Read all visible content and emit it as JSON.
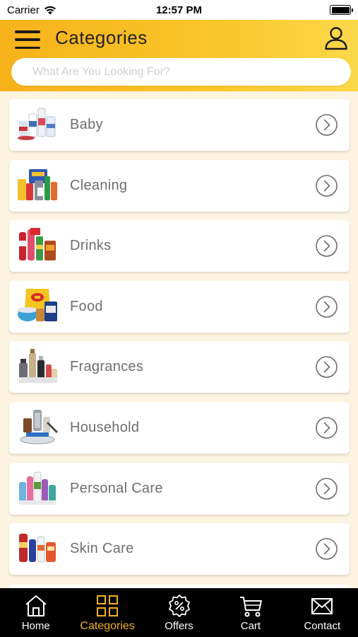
{
  "status_bar": {
    "carrier": "Carrier",
    "time": "12:57 PM"
  },
  "header": {
    "title": "Categories"
  },
  "search": {
    "placeholder": "What Are You Looking For?",
    "value": ""
  },
  "categories": [
    {
      "label": "Baby",
      "icon": "baby-products-thumbnail"
    },
    {
      "label": "Cleaning",
      "icon": "cleaning-products-thumbnail"
    },
    {
      "label": "Drinks",
      "icon": "drinks-thumbnail"
    },
    {
      "label": "Food",
      "icon": "food-thumbnail"
    },
    {
      "label": "Fragrances",
      "icon": "fragrances-thumbnail"
    },
    {
      "label": "Household",
      "icon": "household-thumbnail"
    },
    {
      "label": "Personal Care",
      "icon": "personal-care-thumbnail"
    },
    {
      "label": "Skin Care",
      "icon": "skin-care-thumbnail"
    }
  ],
  "tabbar": {
    "active": "categories",
    "accent_color": "#f4b024",
    "items": [
      {
        "label": "Home",
        "icon": "home-icon"
      },
      {
        "label": "Categories",
        "icon": "grid-icon"
      },
      {
        "label": "Offers",
        "icon": "offer-badge-icon"
      },
      {
        "label": "Cart",
        "icon": "cart-icon"
      },
      {
        "label": "Contact",
        "icon": "mail-icon"
      }
    ]
  }
}
